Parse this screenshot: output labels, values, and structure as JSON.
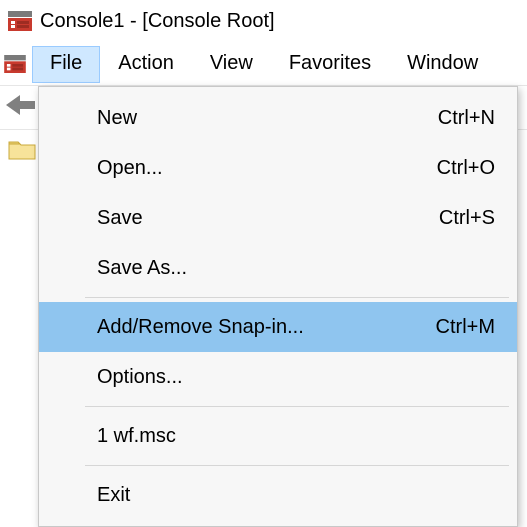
{
  "window": {
    "title": "Console1 - [Console Root]"
  },
  "menubar": {
    "file": "File",
    "action": "Action",
    "view": "View",
    "favorites": "Favorites",
    "window": "Window"
  },
  "file_menu": {
    "new": {
      "label": "New",
      "shortcut": "Ctrl+N"
    },
    "open": {
      "label": "Open...",
      "shortcut": "Ctrl+O"
    },
    "save": {
      "label": "Save",
      "shortcut": "Ctrl+S"
    },
    "save_as": {
      "label": "Save As...",
      "shortcut": ""
    },
    "add_remove": {
      "label": "Add/Remove Snap-in...",
      "shortcut": "Ctrl+M"
    },
    "options": {
      "label": "Options...",
      "shortcut": ""
    },
    "recent1": {
      "label": "1 wf.msc",
      "shortcut": ""
    },
    "exit": {
      "label": "Exit",
      "shortcut": ""
    }
  }
}
